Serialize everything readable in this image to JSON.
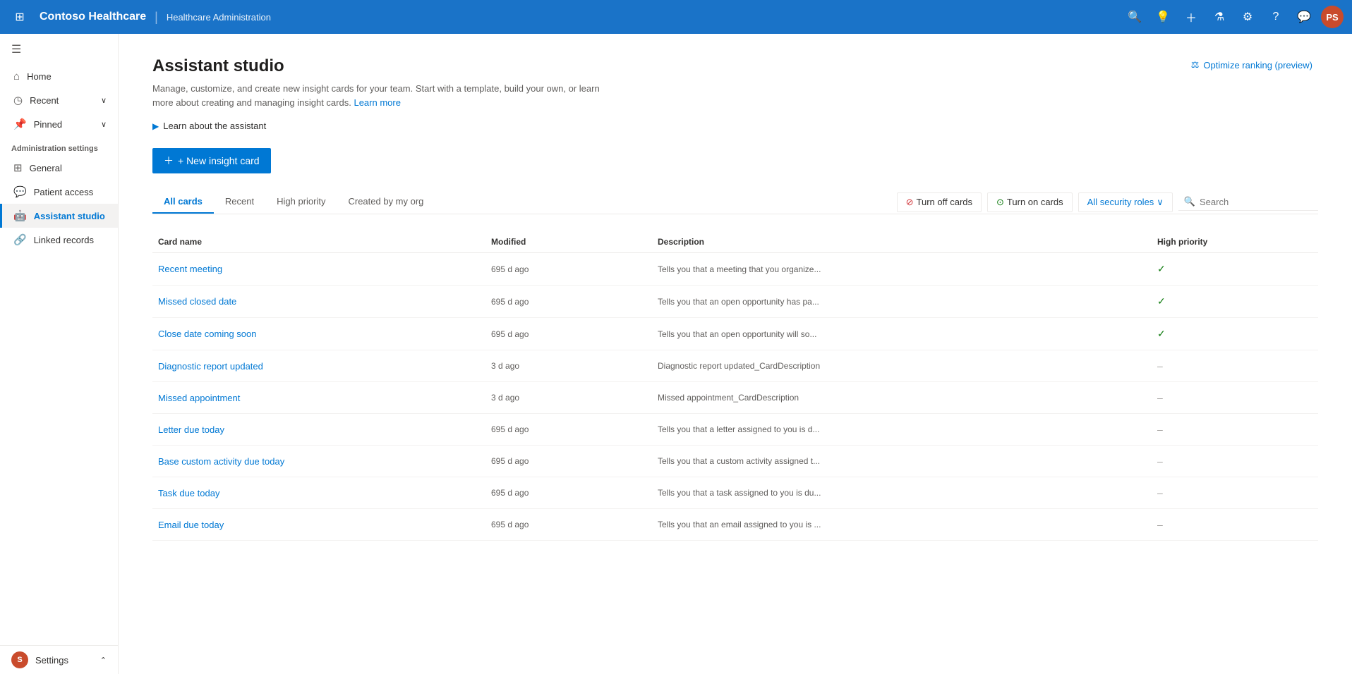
{
  "topbar": {
    "app_name": "Contoso Healthcare",
    "divider": "|",
    "subtitle": "Healthcare Administration",
    "icons": [
      "search",
      "lightbulb",
      "plus",
      "filter",
      "settings",
      "help",
      "chat"
    ],
    "avatar_initials": "PS",
    "optimize_btn": "Optimize ranking (preview)"
  },
  "sidebar": {
    "hamburger": "≡",
    "nav_items": [
      {
        "id": "home",
        "label": "Home",
        "icon": "⊙"
      },
      {
        "id": "recent",
        "label": "Recent",
        "icon": "◷",
        "has_chevron": true
      },
      {
        "id": "pinned",
        "label": "Pinned",
        "icon": "📌",
        "has_chevron": true
      }
    ],
    "section_label": "Administration settings",
    "admin_items": [
      {
        "id": "general",
        "label": "General",
        "icon": "⊞"
      },
      {
        "id": "patient-access",
        "label": "Patient access",
        "icon": "💬"
      },
      {
        "id": "assistant-studio",
        "label": "Assistant studio",
        "icon": "🤖",
        "active": true
      },
      {
        "id": "linked-records",
        "label": "Linked records",
        "icon": "🔗"
      }
    ],
    "bottom": {
      "label": "Settings",
      "avatar_initials": "S",
      "chevron": "⌃"
    }
  },
  "main": {
    "page_title": "Assistant studio",
    "page_description": "Manage, customize, and create new insight cards for your team. Start with a template, build your own, or learn more about creating and managing insight cards.",
    "learn_more_link": "Learn more",
    "learn_section": "Learn about the assistant",
    "new_card_btn": "+ New insight card",
    "tabs": [
      {
        "id": "all-cards",
        "label": "All cards",
        "active": true
      },
      {
        "id": "recent",
        "label": "Recent"
      },
      {
        "id": "high-priority",
        "label": "High priority"
      },
      {
        "id": "created-by-my-org",
        "label": "Created by my org"
      }
    ],
    "action_buttons": {
      "turn_off": "Turn off cards",
      "turn_on": "Turn on cards",
      "security_roles": "All security roles",
      "search_placeholder": "Search"
    },
    "table": {
      "columns": [
        "Card name",
        "Modified",
        "Description",
        "High priority"
      ],
      "rows": [
        {
          "name": "Recent meeting",
          "modified": "695 d ago",
          "description": "Tells you that a meeting that you organize...",
          "high_priority": "check"
        },
        {
          "name": "Missed closed date",
          "modified": "695 d ago",
          "description": "Tells you that an open opportunity has pa...",
          "high_priority": "check"
        },
        {
          "name": "Close date coming soon",
          "modified": "695 d ago",
          "description": "Tells you that an open opportunity will so...",
          "high_priority": "check"
        },
        {
          "name": "Diagnostic report updated",
          "modified": "3 d ago",
          "description": "Diagnostic report updated_CardDescription",
          "high_priority": "dash"
        },
        {
          "name": "Missed appointment",
          "modified": "3 d ago",
          "description": "Missed appointment_CardDescription",
          "high_priority": "dash"
        },
        {
          "name": "Letter due today",
          "modified": "695 d ago",
          "description": "Tells you that a letter assigned to you is d...",
          "high_priority": "dash"
        },
        {
          "name": "Base custom activity due today",
          "modified": "695 d ago",
          "description": "Tells you that a custom activity assigned t...",
          "high_priority": "dash"
        },
        {
          "name": "Task due today",
          "modified": "695 d ago",
          "description": "Tells you that a task assigned to you is du...",
          "high_priority": "dash"
        },
        {
          "name": "Email due today",
          "modified": "695 d ago",
          "description": "Tells you that an email assigned to you is ...",
          "high_priority": "dash"
        }
      ]
    }
  }
}
